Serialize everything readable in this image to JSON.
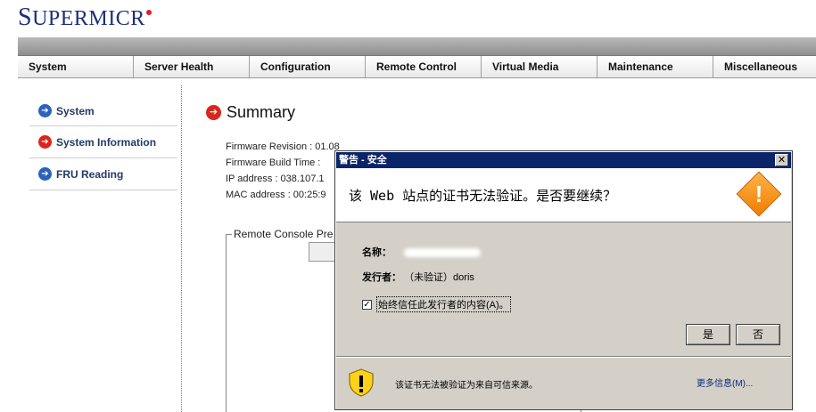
{
  "brand": {
    "logo_text": "SUPERMICR",
    "logo_first": "S"
  },
  "nav": {
    "items": [
      {
        "label": "System"
      },
      {
        "label": "Server Health"
      },
      {
        "label": "Configuration"
      },
      {
        "label": "Remote Control"
      },
      {
        "label": "Virtual Media"
      },
      {
        "label": "Maintenance"
      },
      {
        "label": "Miscellaneous"
      }
    ]
  },
  "sidebar": {
    "items": [
      {
        "label": "System",
        "icon": "blue-arrow-icon",
        "active": false
      },
      {
        "label": "System Information",
        "icon": "red-arrow-icon",
        "active": true
      },
      {
        "label": "FRU Reading",
        "icon": "blue-arrow-icon",
        "active": false
      }
    ]
  },
  "main": {
    "title": "Summary",
    "firmware_revision": "Firmware Revision : 01.08",
    "firmware_build_time": "Firmware Build Time :",
    "ip_address": "IP address : 038.107.1",
    "mac_address": "MAC address : 00:25:9",
    "console_label": "Remote Console Pre"
  },
  "dialog": {
    "title": "警告 - 安全",
    "close_label": "✕",
    "question": "该 Web 站点的证书无法验证。是否要继续？",
    "name_label": "名称：",
    "issuer_label": "发行者：",
    "issuer_value": "（未验证）doris",
    "checkbox_label": "始终信任此发行者的内容(A)。",
    "checkbox_checked": true,
    "yes_label": "是",
    "no_label": "否",
    "footer_text": "该证书无法被验证为来自可信来源。",
    "more_info_label": "更多信息(M)..."
  },
  "colors": {
    "brand_blue": "#1d2f7a",
    "dialog_title_bg": "#0a246a",
    "warning_orange": "#f07c00",
    "arrow_blue": "#2a63b8",
    "arrow_red": "#d9261c"
  }
}
